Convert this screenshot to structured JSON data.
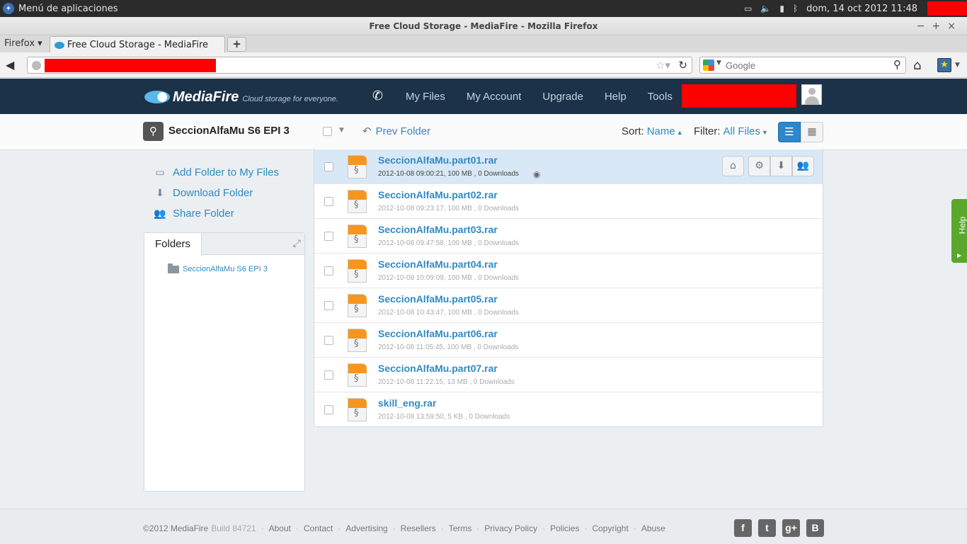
{
  "os_panel": {
    "app_menu": "Menú de aplicaciones",
    "clock": "dom, 14 oct 2012 11:48",
    "icons": [
      "window-switcher-icon",
      "volume-icon",
      "signal-icon",
      "bluetooth-icon"
    ]
  },
  "browser": {
    "window_title": "Free Cloud Storage - MediaFire - Mozilla Firefox",
    "firefox_menu": "Firefox",
    "tab_title": "Free Cloud Storage - MediaFire",
    "new_tab_label": "+",
    "search_placeholder": "Google"
  },
  "header": {
    "brand": "MediaFire",
    "tagline": "Cloud storage for everyone.",
    "nav": [
      "My Files",
      "My Account",
      "Upgrade",
      "Help",
      "Tools"
    ]
  },
  "toolbar": {
    "folder_name": "SeccionAlfaMu S6 EPI 3",
    "prev_folder": "Prev Folder",
    "sort_label": "Sort:",
    "sort_value": "Name",
    "filter_label": "Filter:",
    "filter_value": "All Files"
  },
  "sidebar": {
    "actions": [
      {
        "label": "Add Folder to My Files",
        "icon": "folder-icon"
      },
      {
        "label": "Download Folder",
        "icon": "download-icon"
      },
      {
        "label": "Share Folder",
        "icon": "share-icon"
      }
    ],
    "folders_tab": "Folders",
    "tree_item": "SeccionAlfaMu S6 EPI 3"
  },
  "files": [
    {
      "name": "SeccionAlfaMu.part01.rar",
      "meta": "2012-10-08 09:00:21, 100 MB , 0 Downloads",
      "selected": true
    },
    {
      "name": "SeccionAlfaMu.part02.rar",
      "meta": "2012-10-08 09:23:17, 100 MB , 0 Downloads"
    },
    {
      "name": "SeccionAlfaMu.part03.rar",
      "meta": "2012-10-08 09:47:58, 100 MB , 0 Downloads"
    },
    {
      "name": "SeccionAlfaMu.part04.rar",
      "meta": "2012-10-08 10:09:09, 100 MB , 0 Downloads"
    },
    {
      "name": "SeccionAlfaMu.part05.rar",
      "meta": "2012-10-08 10:43:47, 100 MB , 0 Downloads"
    },
    {
      "name": "SeccionAlfaMu.part06.rar",
      "meta": "2012-10-08 11:05:45, 100 MB , 0 Downloads"
    },
    {
      "name": "SeccionAlfaMu.part07.rar",
      "meta": "2012-10-08 11:22:15, 13 MB , 0 Downloads"
    },
    {
      "name": "skill_eng.rar",
      "meta": "2012-10-08 13:59:50, 5 KB , 0 Downloads"
    }
  ],
  "help_tab": "Help",
  "footer": {
    "copyright": "©2012 MediaFire",
    "build": "Build 84721",
    "links": [
      "About",
      "Contact",
      "Advertising",
      "Resellers",
      "Terms",
      "Privacy Policy",
      "Policies",
      "Copyright",
      "Abuse"
    ],
    "social": [
      "f",
      "t",
      "g+",
      "B"
    ]
  },
  "colors": {
    "header_bg": "#1b3248",
    "link_blue": "#2f8ac4",
    "selected_row": "#d9e8f6",
    "file_icon_orange": "#f6961e",
    "help_green": "#5aa72d"
  }
}
